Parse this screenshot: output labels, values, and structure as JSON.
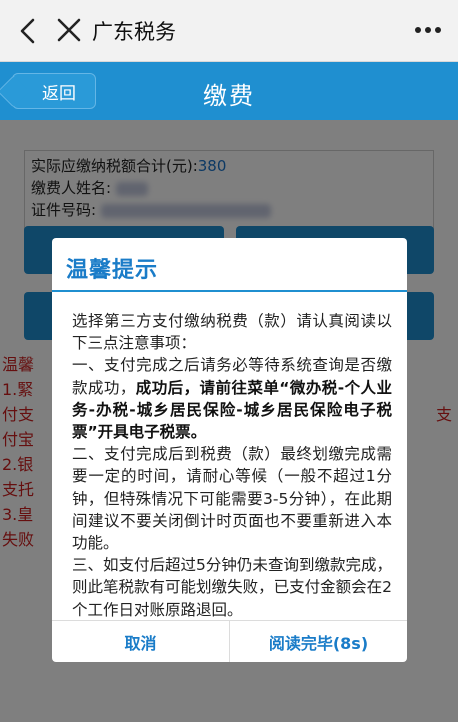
{
  "topbar": {
    "title": "广东税务"
  },
  "header": {
    "back_label": "返回",
    "title": "缴费"
  },
  "info": {
    "amount_label": "实际应缴纳税额合计(元):",
    "amount_value": "380",
    "name_label": "缴费人姓名:",
    "id_label": "证件号码:"
  },
  "background_notes": {
    "title": "温馨",
    "lines": [
      "1.緊",
      "付支",
      "付宝",
      "2.银",
      "支托",
      "3.皇",
      "失败"
    ],
    "right_fragment": "支"
  },
  "dialog": {
    "title": "温馨提示",
    "intro": "选择第三方支付缴纳税费（款）请认真阅读以下三点注意事项：",
    "item1_pre": "一、支付完成之后请务必等待系统查询是否缴款成功，",
    "item1_bold": "成功后，请前往菜单“微办税-个人业务-办税-城乡居民保险-城乡居民保险电子税票”开具电子税票。",
    "item2": "二、支付完成后到税费（款）最终划缴完成需要一定的时间，请耐心等候（一般不超过1分钟，但特殊情况下可能需要3-5分钟），在此期间建议不要关闭倒计时页面也不要重新进入本功能。",
    "item3": "三、如支付后超过5分钟仍未查询到缴款完成，则此笔税款有可能划缴失败，已支付金额会在2个工作日对账原路退回。",
    "cancel_label": "取消",
    "confirm_label": "阅读完毕(8s)"
  },
  "colors": {
    "brand_blue": "#1f8fd0",
    "accent_text": "#1a7cc8",
    "warning_red": "#cc1f1f"
  },
  "icons": {
    "back": "chevron-left-icon",
    "close": "close-icon",
    "more": "more-dots-icon"
  }
}
